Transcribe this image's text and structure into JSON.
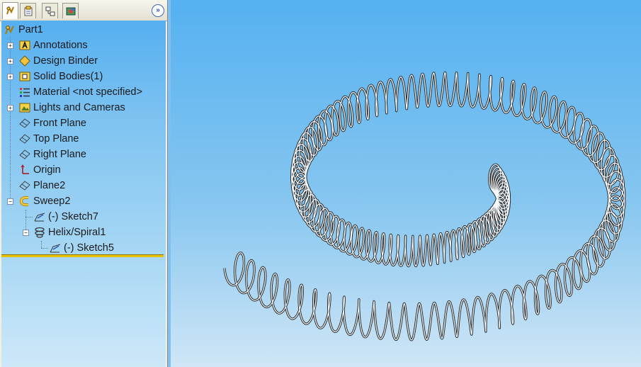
{
  "feature_tree": {
    "root": "Part1",
    "items": [
      {
        "label": "Annotations",
        "icon": "annotations-icon"
      },
      {
        "label": "Design Binder",
        "icon": "design-binder-icon"
      },
      {
        "label": "Solid Bodies(1)",
        "icon": "solid-bodies-icon"
      },
      {
        "label": "Material <not specified>",
        "icon": "material-icon"
      },
      {
        "label": "Lights and Cameras",
        "icon": "lights-cameras-icon"
      },
      {
        "label": "Front Plane",
        "icon": "plane-icon"
      },
      {
        "label": "Top Plane",
        "icon": "plane-icon"
      },
      {
        "label": "Right Plane",
        "icon": "plane-icon"
      },
      {
        "label": "Origin",
        "icon": "origin-icon"
      },
      {
        "label": "Plane2",
        "icon": "plane-icon"
      },
      {
        "label": "Sweep2",
        "icon": "sweep-icon"
      },
      {
        "label": "(-) Sketch7",
        "icon": "sketch-icon"
      },
      {
        "label": "Helix/Spiral1",
        "icon": "helix-icon"
      },
      {
        "label": "(-) Sketch5",
        "icon": "sketch-icon"
      }
    ]
  },
  "tabs": [
    "feature-manager-tab",
    "property-manager-tab",
    "configuration-manager-tab",
    "display-manager-tab"
  ],
  "colors": {
    "tree_top": "#55aff0",
    "viewport_top": "#55b1f1",
    "rollback_bar": "#e8c200",
    "spring_edge": "#222222"
  }
}
